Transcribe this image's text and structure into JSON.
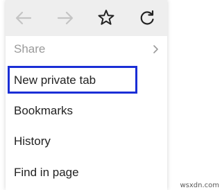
{
  "toolbar": {
    "back_icon": "arrow-left-icon",
    "forward_icon": "arrow-right-icon",
    "bookmark_icon": "star-icon",
    "reload_icon": "reload-icon",
    "colors": {
      "disabled": "#c4c4c4",
      "active": "#222222",
      "background": "#eeeeee"
    }
  },
  "menu": {
    "items": [
      {
        "label": "Share",
        "enabled": false,
        "has_submenu": true
      },
      {
        "label": "New private tab",
        "enabled": true,
        "highlighted": true
      },
      {
        "label": "Bookmarks",
        "enabled": true
      },
      {
        "label": "History",
        "enabled": true
      },
      {
        "label": "Find in page",
        "enabled": true
      }
    ],
    "highlight_color": "#1a2ed6"
  },
  "watermark": "wsxdn.com"
}
